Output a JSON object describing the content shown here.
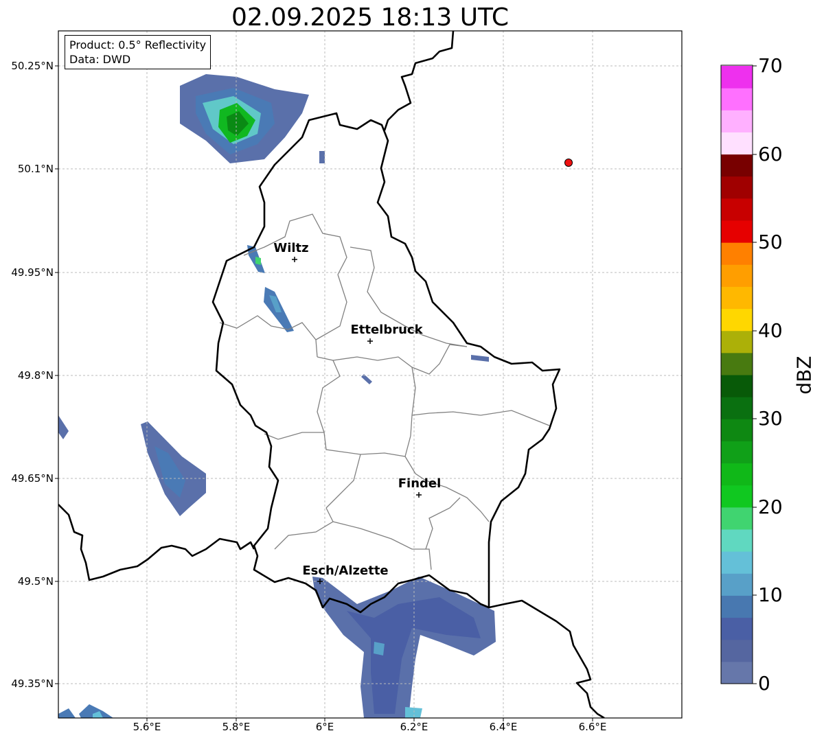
{
  "title": "02.09.2025 18:13 UTC",
  "info": {
    "product": "Product: 0.5° Reflectivity",
    "source": "Data: DWD"
  },
  "axes": {
    "lat_ticks": [
      "50.25°N",
      "50.1°N",
      "49.95°N",
      "49.8°N",
      "49.65°N",
      "49.5°N",
      "49.35°N"
    ],
    "lon_ticks": [
      "5.6°E",
      "5.8°E",
      "6°E",
      "6.2°E",
      "6.4°E",
      "6.6°E"
    ],
    "grid": true
  },
  "cities": [
    {
      "name": "Wiltz",
      "lon": 5.93,
      "lat": 49.97
    },
    {
      "name": "Ettelbruck",
      "lon": 6.1,
      "lat": 49.85
    },
    {
      "name": "Findel",
      "lon": 6.21,
      "lat": 49.63
    },
    {
      "name": "Esch/Alzette",
      "lon": 5.98,
      "lat": 49.5
    }
  ],
  "marker": {
    "lon": 6.55,
    "lat": 50.11,
    "color": "#ee1111"
  },
  "colorbar": {
    "unit": "dBZ",
    "ticks": [
      "0",
      "10",
      "20",
      "30",
      "40",
      "50",
      "60",
      "70"
    ],
    "colors": [
      "#6677aa",
      "#5566a0",
      "#4a5fa5",
      "#4878b0",
      "#58a0c8",
      "#64c0d8",
      "#60d8c0",
      "#40d470",
      "#10c820",
      "#10b818",
      "#10a018",
      "#0e8812",
      "#0a7010",
      "#085a08",
      "#487a10",
      "#acb008",
      "#ffd700",
      "#ffb800",
      "#ff9e00",
      "#ff8000",
      "#e60000",
      "#c80000",
      "#a00000",
      "#780000",
      "#ffe0ff",
      "#ffb0ff",
      "#ff70ff",
      "#ee30ee"
    ]
  },
  "colors": {
    "border": "#000000",
    "cantons": "#808080",
    "grid": "#bbbbbb"
  }
}
